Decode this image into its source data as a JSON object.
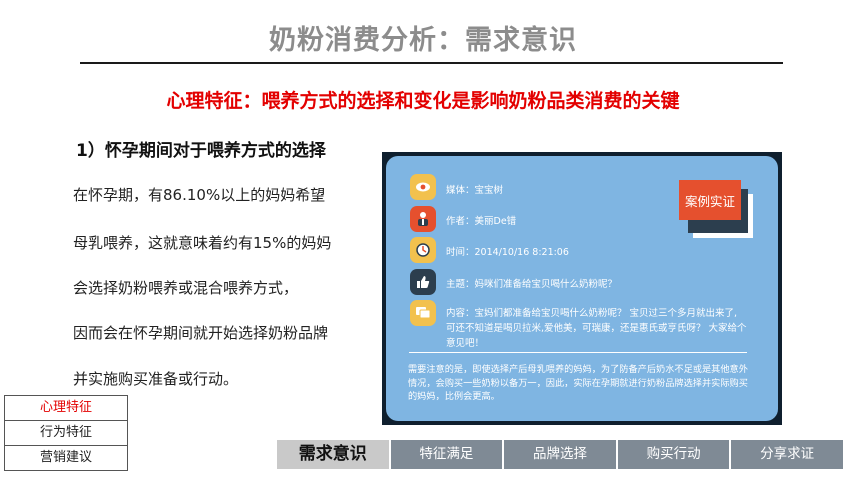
{
  "header": {
    "title": "奶粉消费分析：需求意识"
  },
  "subtitle": "心理特征：喂养方式的选择和变化是影响奶粉品类消费的关键",
  "question": "1）怀孕期间对于喂养方式的选择",
  "paragraph": [
    "在怀孕期，有86.10%以上的妈妈希望",
    "母乳喂养，这就意味着约有15%的妈妈",
    "会选择奶粉喂养或混合喂养方式，",
    "因而会在怀孕期间就开始选择奶粉品牌",
    "并实施购买准备或行动。"
  ],
  "side_nav": {
    "items": [
      "心理特征",
      "行为特征",
      "营销建议"
    ],
    "active": "心理特征"
  },
  "card": {
    "stamp": "案例实证",
    "rows": [
      {
        "icon": "eye-icon",
        "color": "#f2c14e",
        "lines": [
          "媒体：宝宝树"
        ]
      },
      {
        "icon": "person-icon",
        "color": "#e5502e",
        "lines": [
          "作者：美丽De错"
        ]
      },
      {
        "icon": "clock-icon",
        "color": "#f2c14e",
        "lines": [
          "时间：2014/10/16  8:21:06"
        ]
      },
      {
        "icon": "thumbs-up-icon",
        "color": "#2c3e4e",
        "lines": [
          "主题：妈咪们准备给宝贝喝什么奶粉呢？"
        ]
      },
      {
        "icon": "chat-icon",
        "color": "#f2c14e",
        "lines": [
          "内容：宝妈们都准备给宝贝喝什么奶粉呢？ 宝贝过三个多月就出来了,",
          "可还不知道是喝贝拉米,爱他美，可瑞康，还是惠氏或亨氏呀？ 大家给个",
          "意见吧！"
        ]
      }
    ],
    "note": "需要注意的是，即使选择产后母乳喂养的妈妈，为了防备产后奶水不足或是其他意外情况，会购买一些奶粉以备万一，因此，实际在孕期就进行奶粉品牌选择并实际购买的妈妈，比例会更高。"
  },
  "tabs": {
    "items": [
      "需求意识",
      "特征满足",
      "品牌选择",
      "购买行动",
      "分享求证"
    ],
    "active": "需求意识"
  }
}
